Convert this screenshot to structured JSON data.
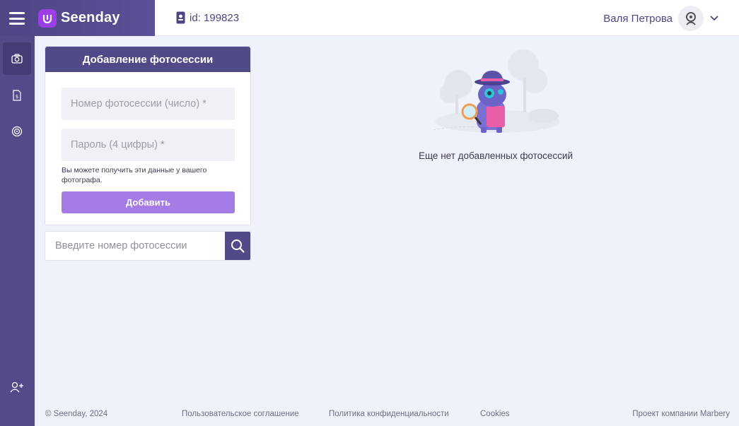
{
  "header": {
    "brand_name": "Seenday",
    "user_id": "id: 199823",
    "user_name": "Валя Петрова"
  },
  "sidebar": {
    "items": [
      {
        "icon": "camera-icon",
        "active": true
      },
      {
        "icon": "document-dollar-icon",
        "active": false
      },
      {
        "icon": "target-icon",
        "active": false
      },
      {
        "icon": "add-user-icon",
        "active": false
      }
    ]
  },
  "add_card": {
    "title": "Добавление фотосессии",
    "session_placeholder": "Номер фотосессии (число) *",
    "password_placeholder": "Пароль (4 цифры) *",
    "hint": "Вы можете получить эти данные у вашего фотографа.",
    "submit_label": "Добавить"
  },
  "search": {
    "placeholder": "Введите номер фотосессии"
  },
  "empty_state": {
    "text": "Еще нет добавленных фотосессий"
  },
  "footer": {
    "copyright": "© Seenday, 2024",
    "terms": "Пользовательское соглашение",
    "privacy": "Политика конфиденциальности",
    "cookies": "Cookies",
    "project": "Проект компании Marbery"
  },
  "colors": {
    "primary": "#514a89",
    "accent": "#a57be6",
    "logo": "#9b3ee6",
    "background": "#eff2fb"
  }
}
